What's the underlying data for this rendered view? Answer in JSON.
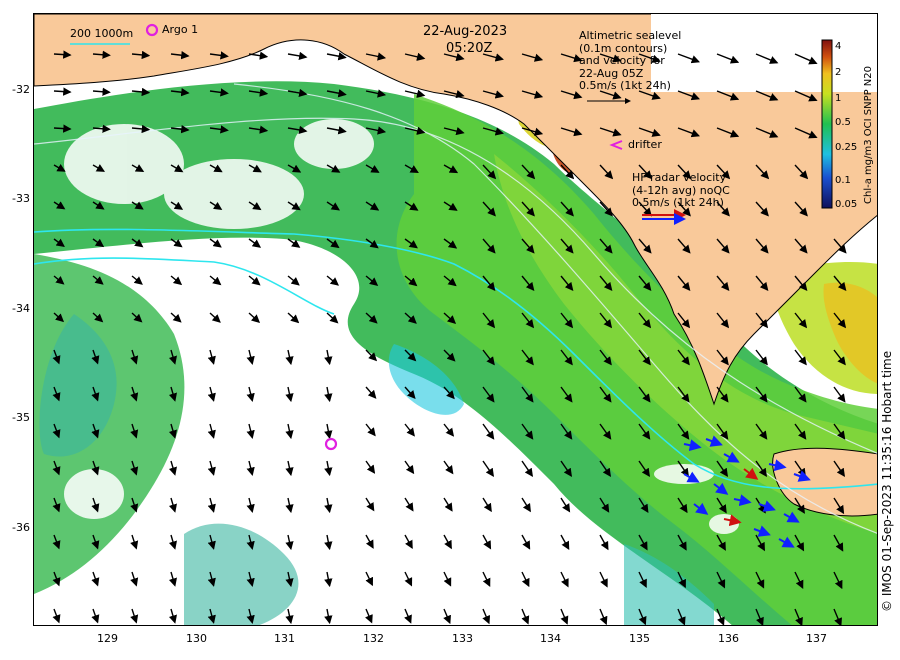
{
  "map": {
    "date": "22-Aug-2023",
    "time": "05:20Z",
    "isobaths_label": "200  1000m",
    "argo_label": "Argo 1",
    "altimetry_label": [
      "Altimetric sealevel",
      "(0.1m contours)",
      "and velocity for",
      "22-Aug 05Z",
      "0.5m/s (1kt 24h)"
    ],
    "drifter_label": "drifter",
    "hf_label": [
      "HF radar velocity",
      "(4-12h avg) noQC",
      "0.5m/s (1kt 24h)"
    ],
    "lon_ticks": [
      "129",
      "130",
      "131",
      "132",
      "133",
      "134",
      "135",
      "136",
      "137"
    ],
    "lat_ticks": [
      "-32",
      "-33",
      "-34",
      "-35",
      "-36"
    ],
    "lon_range": [
      128.0,
      137.5
    ],
    "lat_range": [
      -31.3,
      -36.9
    ],
    "colorbar": {
      "title": "Chl-a mg/m3 OCI SNPP N20",
      "ticks": [
        "4",
        "2",
        "1",
        "0.5",
        "0.25",
        "0.1",
        "0.05"
      ],
      "scale": "log",
      "range": [
        0.05,
        5
      ]
    },
    "credit": "© IMOS 01-Sep-2023 11:35:16 Hobart time",
    "colors": {
      "land": "#f9c99a",
      "isobath": "#2ee6ee",
      "argo": "#e020e0",
      "hf_arrow": "#1020ff",
      "hf_arrow_alt": "#d01010"
    }
  }
}
